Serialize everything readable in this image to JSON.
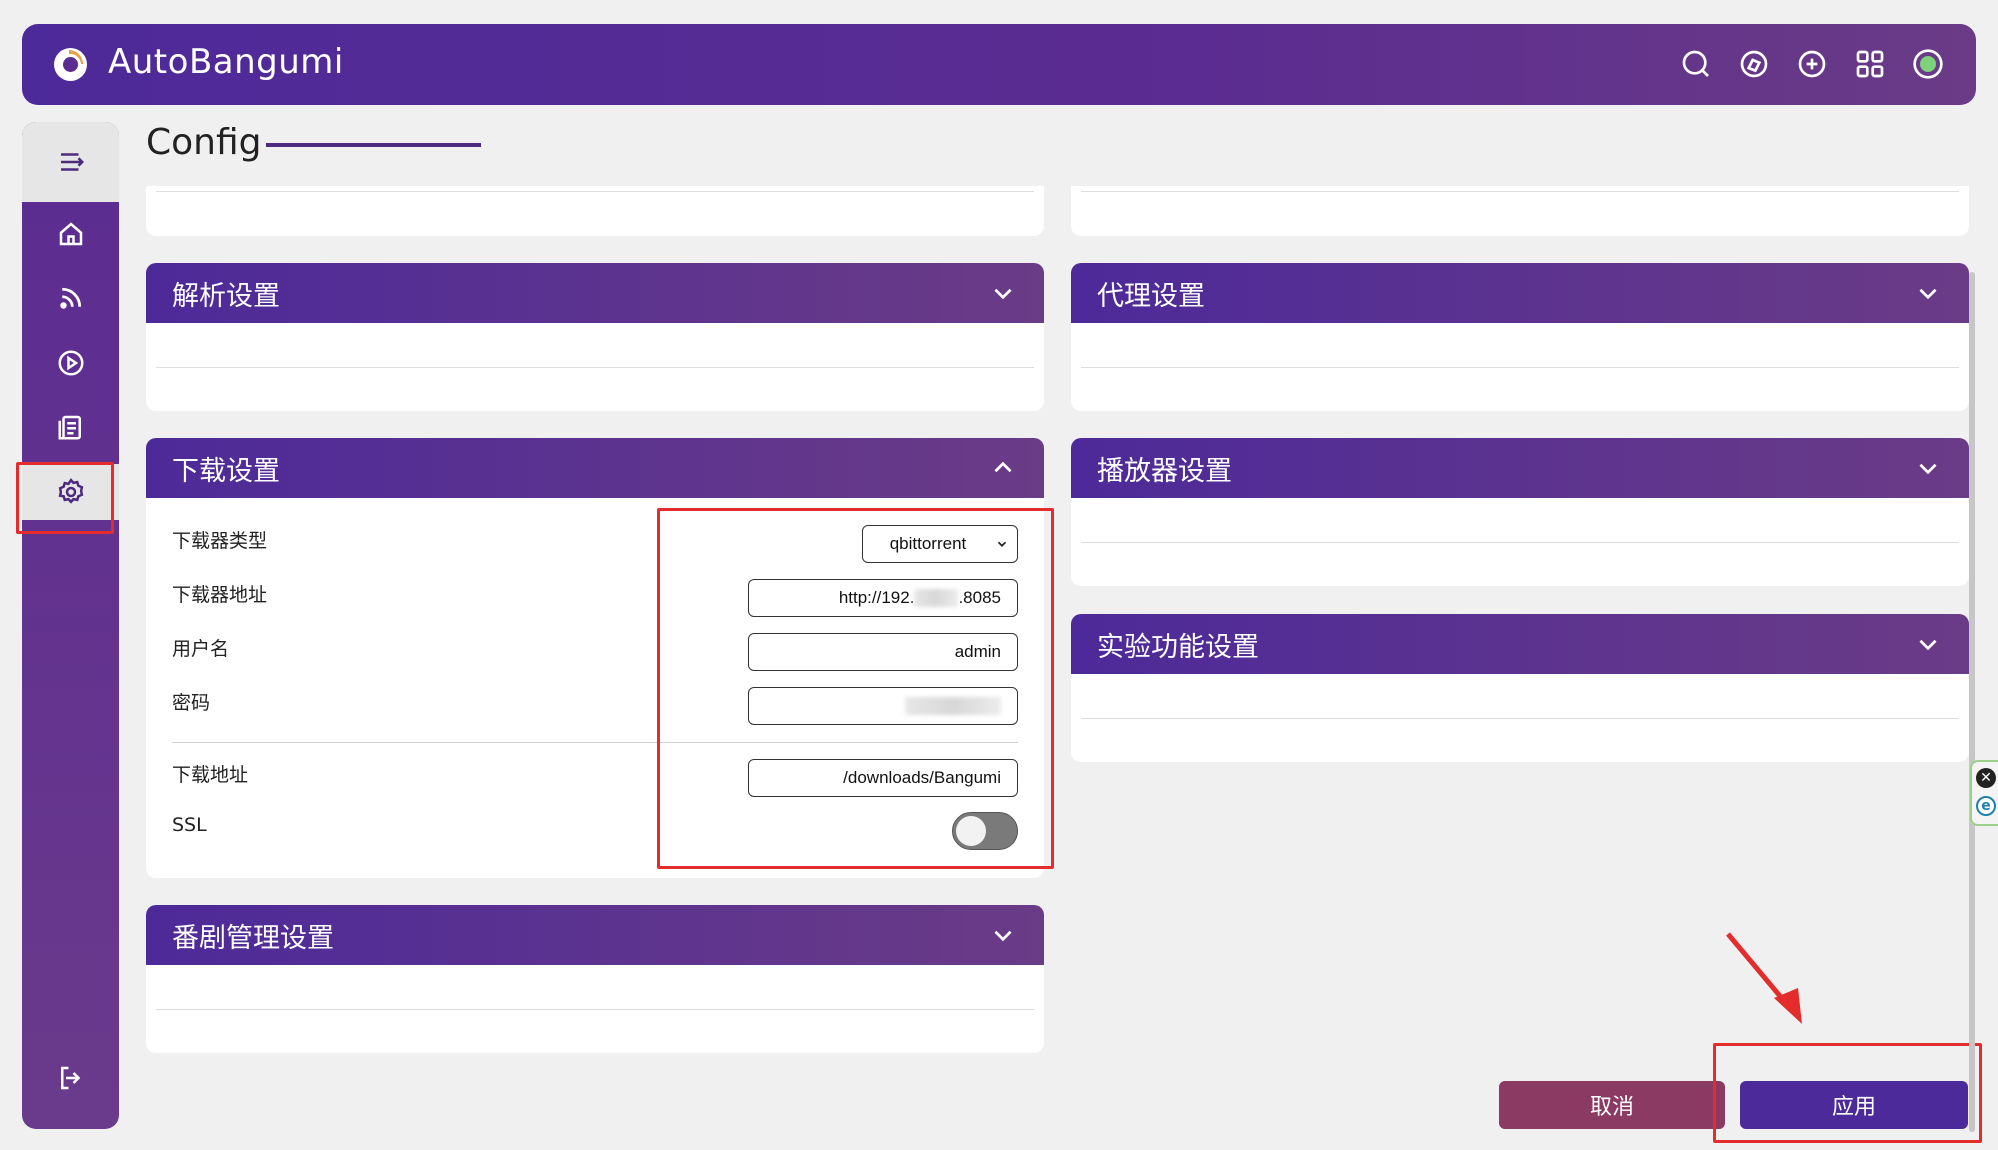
{
  "app": {
    "title": "AutoBangumi"
  },
  "page": {
    "title": "Config"
  },
  "top_icons": [
    "search-icon",
    "rss-compass-icon",
    "add-icon",
    "grid-icon",
    "status-dot-icon"
  ],
  "sidebar": [
    "menu-icon",
    "home-icon",
    "rss-icon",
    "play-icon",
    "log-icon",
    "settings-icon",
    "logout-icon"
  ],
  "sections": {
    "parse": {
      "title": "解析设置"
    },
    "proxy": {
      "title": "代理设置"
    },
    "download": {
      "title": "下载设置",
      "fields": {
        "downloader_type": {
          "label": "下载器类型",
          "value": "qbittorrent"
        },
        "downloader_host": {
          "label": "下载器地址",
          "value_prefix": "http://192.",
          "value_suffix": ".8085"
        },
        "username": {
          "label": "用户名",
          "value": "admin"
        },
        "password": {
          "label": "密码",
          "value": ""
        },
        "download_path": {
          "label": "下载地址",
          "value": "/downloads/Bangumi"
        },
        "ssl": {
          "label": "SSL",
          "enabled": false
        }
      }
    },
    "player": {
      "title": "播放器设置"
    },
    "experimental": {
      "title": "实验功能设置"
    },
    "bangumi_manage": {
      "title": "番剧管理设置"
    }
  },
  "actions": {
    "cancel": "取消",
    "apply": "应用"
  },
  "colors": {
    "primary": "#4d2a99",
    "cancel": "#8a3a63",
    "apply": "#4d2a99",
    "highlight": "#e52c2c"
  }
}
